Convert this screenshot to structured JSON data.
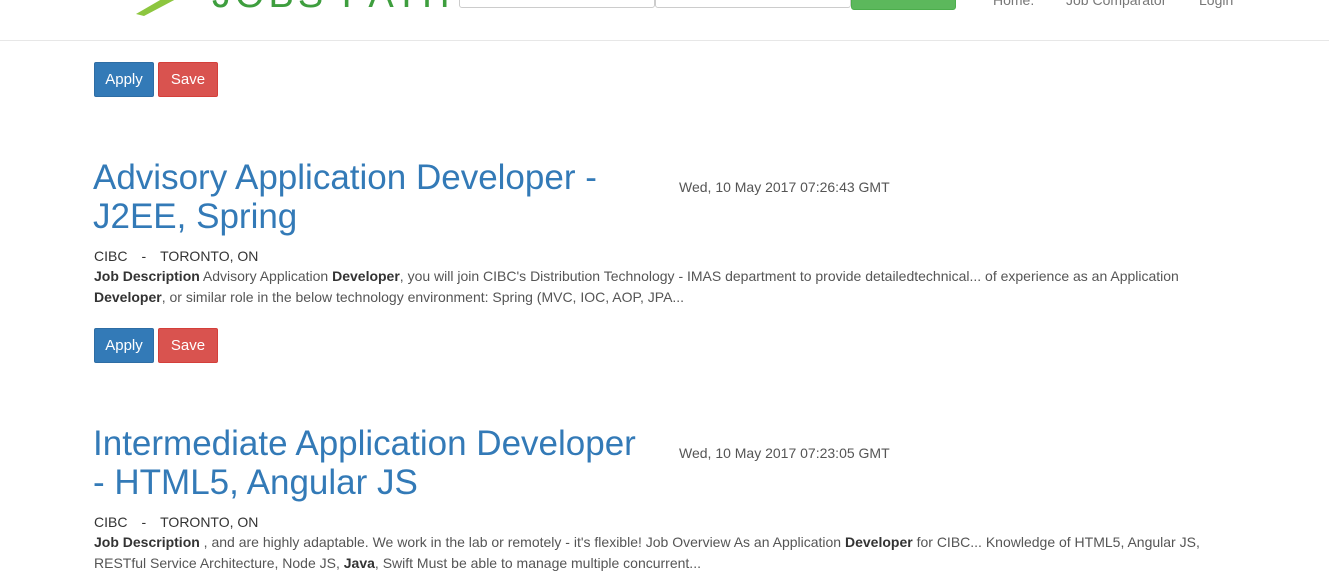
{
  "navbar": {
    "logo_text": "JOBS PATH",
    "links": [
      "Home.",
      "Job Comparator",
      "Login"
    ]
  },
  "top_actions": {
    "apply_label": "Apply",
    "save_label": "Save"
  },
  "jobs": [
    {
      "title": "Advisory Application Developer - J2EE, Spring",
      "date": "Wed, 10 May 2017 07:26:43 GMT",
      "company": "CIBC",
      "separator": "-",
      "location": "TORONTO, ON",
      "description": [
        {
          "text": "Job Description",
          "bold": true
        },
        {
          "text": " Advisory Application ",
          "bold": false
        },
        {
          "text": "Developer",
          "bold": true
        },
        {
          "text": ", you will join CIBC's Distribution Technology - IMAS department to provide detailedtechnical... of experience as an Application ",
          "bold": false
        },
        {
          "text": "Developer",
          "bold": true
        },
        {
          "text": ", or similar role in the below technology environment: Spring (MVC, IOC, AOP, JPA...",
          "bold": false
        }
      ],
      "apply_label": "Apply",
      "save_label": "Save"
    },
    {
      "title": "Intermediate Application Developer - HTML5, Angular JS",
      "date": "Wed, 10 May 2017 07:23:05 GMT",
      "company": "CIBC",
      "separator": "-",
      "location": "TORONTO, ON",
      "description": [
        {
          "text": "Job Description",
          "bold": true
        },
        {
          "text": " , and are highly adaptable. We work in the lab or remotely - it's flexible! Job Overview As an Application ",
          "bold": false
        },
        {
          "text": "Developer",
          "bold": true
        },
        {
          "text": " for CIBC... Knowledge of HTML5, Angular JS, RESTful Service Architecture, Node JS, ",
          "bold": false
        },
        {
          "text": "Java",
          "bold": true
        },
        {
          "text": ", Swift Must be able to manage multiple concurrent...",
          "bold": false
        }
      ]
    }
  ],
  "colors": {
    "link_blue": "#337ab7",
    "apply_blue": "#337ab7",
    "save_red": "#d9534f",
    "search_green": "#5cb85c",
    "logo_green": "#3e9e3e"
  }
}
